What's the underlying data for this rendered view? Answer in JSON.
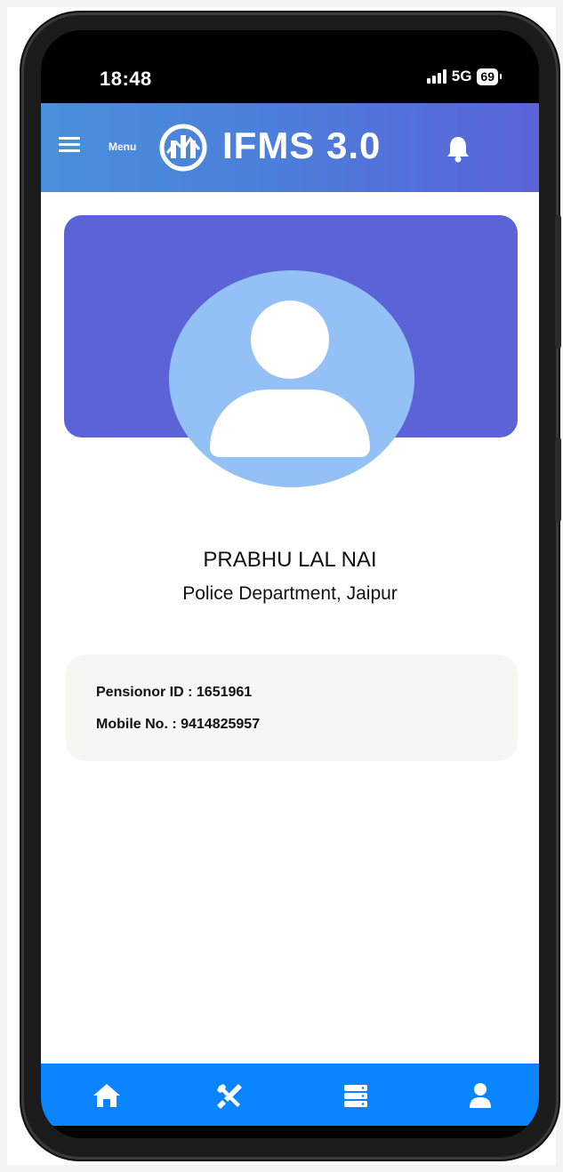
{
  "status_bar": {
    "time": "18:48",
    "network": "5G",
    "battery": "69"
  },
  "header": {
    "menu_label": "Menu",
    "title": "IFMS 3.0",
    "gradient_start": "#4a90d9",
    "gradient_end": "#5a63d8",
    "icons": [
      "hamburger-icon",
      "logo-icon",
      "bell-icon"
    ]
  },
  "profile": {
    "banner_color": "#5b63d6",
    "avatar_color": "#93c0f5",
    "name": "PRABHU LAL NAI",
    "department": "Police Department, Jaipur"
  },
  "info": {
    "pensioner_id": "Pensionor ID : 1651961",
    "mobile": "Mobile No. : 9414825957"
  },
  "bottom_nav": {
    "color": "#0a84ff",
    "items": [
      "home-icon",
      "tools-icon",
      "list-icon",
      "user-icon"
    ]
  }
}
